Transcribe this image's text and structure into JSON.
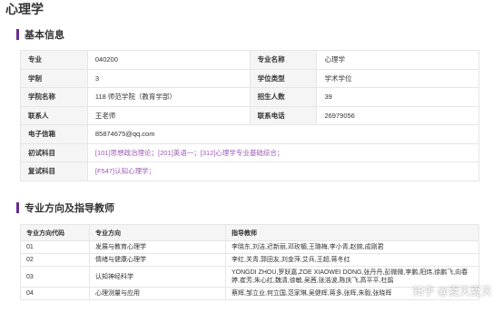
{
  "page": {
    "title": "心理学"
  },
  "basic": {
    "title": "基本信息",
    "rows": [
      {
        "l1": "专业",
        "v1": "040200",
        "l2": "专业名称",
        "v2": "心理学"
      },
      {
        "l1": "学制",
        "v1": "3",
        "l2": "学位类型",
        "v2": "学术学位"
      },
      {
        "l1": "学院名称",
        "v1": "118 师范学院（教育学部）",
        "l2": "招生人数",
        "v2": "39"
      },
      {
        "l1": "联系人",
        "v1": "王老师",
        "l2": "联系电话",
        "v2": "26979056"
      }
    ],
    "email_label": "电子信箱",
    "email": "85874675@qq.com",
    "exam_label": "初试科目",
    "exam": "[101]思想政治理论；[201]英语一；[312]心理学专业基础综合；",
    "retest_label": "复试科目",
    "retest": "[F547]认知心理学；"
  },
  "directions": {
    "title": "专业方向及指导教师",
    "headers": [
      "专业方向代码",
      "专业方向",
      "指导教师"
    ],
    "rows": [
      {
        "code": "01",
        "name": "发展与教育心理学",
        "teachers": "李晓东,刘洁,迟新丽,邓玫楣,王璐梅,李小青,赵婉,成刚君"
      },
      {
        "code": "02",
        "name": "情绪与健康心理学",
        "teachers": "李红,关青,郭田友,刘金萍,艾兵,王超,蒋冬红"
      },
      {
        "code": "03",
        "name": "认知神经科学",
        "teachers": "YONGDI ZHOU,罗跃嘉,ZOE XIAOWEI DONG,张丹丹,彭微微,李鹏,阳炜,徐鹏飞,向春婷,崔芳,朱心红,魏清,徐敏,吴茜,张浩波,陈庆飞,高平平,杜鹃"
      },
      {
        "code": "04",
        "name": "心理测量与应用",
        "teachers": "蔡辉,邹立业,何立国,范家琳,吴健辉,蒋多,张晖,朱毅,张晓晖"
      }
    ]
  },
  "watermark": {
    "text": "知乎 @夏天夏天"
  }
}
